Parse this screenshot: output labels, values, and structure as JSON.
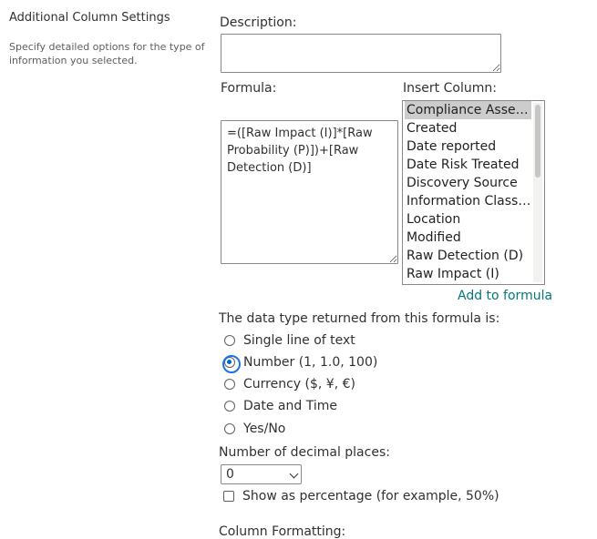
{
  "section": {
    "title": "Additional Column Settings",
    "description": "Specify detailed options for the type of information you selected."
  },
  "description_field": {
    "label": "Description:",
    "value": ""
  },
  "formula": {
    "label": "Formula:",
    "value": "=([Raw Impact (I)]*[Raw Probability (P)])+[Raw Detection (D)]"
  },
  "insert_column": {
    "label": "Insert Column:",
    "items": [
      {
        "label": "Compliance Asset Id",
        "selected": true
      },
      {
        "label": "Created"
      },
      {
        "label": "Date reported"
      },
      {
        "label": "Date Risk Treated"
      },
      {
        "label": "Discovery Source"
      },
      {
        "label": "Information Classifi..."
      },
      {
        "label": "Location"
      },
      {
        "label": "Modified"
      },
      {
        "label": "Raw Detection (D)"
      },
      {
        "label": "Raw Impact (I)"
      }
    ],
    "add_link": "Add to formula"
  },
  "data_type": {
    "label": "The data type returned from this formula is:",
    "options": [
      {
        "label": "Single line of text",
        "checked": false
      },
      {
        "label": "Number (1, 1.0, 100)",
        "checked": true
      },
      {
        "label": "Currency ($, ¥, €)",
        "checked": false
      },
      {
        "label": "Date and Time",
        "checked": false
      },
      {
        "label": "Yes/No",
        "checked": false
      }
    ]
  },
  "decimal_places": {
    "label": "Number of decimal places:",
    "value": "0"
  },
  "show_percentage": {
    "label": "Show as percentage (for example, 50%)",
    "checked": false
  },
  "column_formatting": {
    "label": "Column Formatting:"
  },
  "colors": {
    "link": "#03787c",
    "selected_item": "#cccccc",
    "radio_dot": "#0067b8"
  }
}
